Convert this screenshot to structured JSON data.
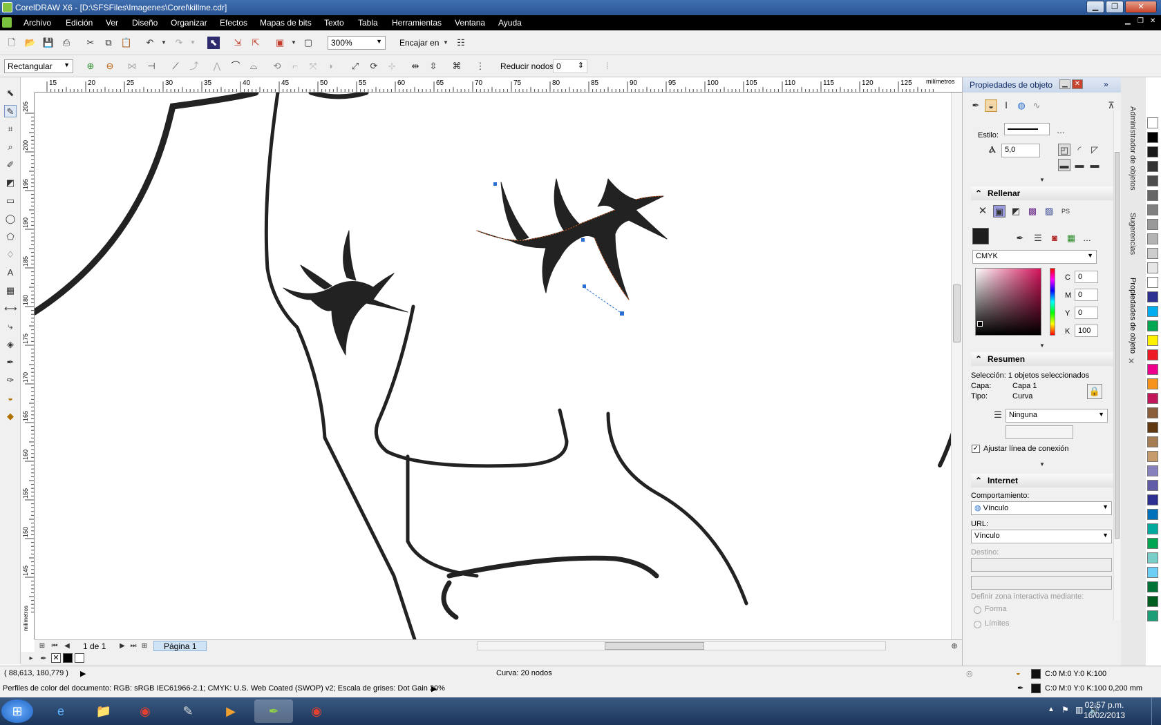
{
  "window": {
    "title": "CorelDRAW X6 - [D:\\SFSFiles\\Imagenes\\Corel\\killme.cdr]"
  },
  "menu": [
    "Archivo",
    "Edición",
    "Ver",
    "Diseño",
    "Organizar",
    "Efectos",
    "Mapas de bits",
    "Texto",
    "Tabla",
    "Herramientas",
    "Ventana",
    "Ayuda"
  ],
  "toolbar": {
    "zoom": "300%",
    "snap_label": "Encajar en"
  },
  "propbar": {
    "mode": "Rectangular",
    "reduce_label": "Reducir nodos",
    "reduce_value": "0"
  },
  "ruler": {
    "h_labels": [
      "15",
      "20",
      "25",
      "30",
      "35",
      "40",
      "45",
      "50",
      "55",
      "60",
      "65",
      "70",
      "75",
      "80",
      "85",
      "90",
      "95",
      "100",
      "105",
      "110",
      "115",
      "120",
      "125"
    ],
    "h_unit": "milímetros",
    "v_labels": [
      "205",
      "200",
      "195",
      "190",
      "185",
      "180",
      "175",
      "170",
      "165",
      "160",
      "155",
      "150",
      "145"
    ],
    "v_unit": "milímetros"
  },
  "pages": {
    "counter": "1 de 1",
    "tab": "Página 1"
  },
  "panel": {
    "title": "Propiedades de objeto",
    "estilo_label": "Estilo:",
    "width_value": "5,0",
    "fill_title": "Rellenar",
    "color_model": "CMYK",
    "cmyk": {
      "c_label": "C",
      "c": "0",
      "m_label": "M",
      "m": "0",
      "y_label": "Y",
      "y": "0",
      "k_label": "K",
      "k": "100"
    },
    "summary_title": "Resumen",
    "selection": "Selección: 1 objetos seleccionados",
    "layer_label": "Capa:",
    "layer_value": "Capa 1",
    "type_label": "Tipo:",
    "type_value": "Curva",
    "wrap_value": "Ninguna",
    "connector_label": "Ajustar línea de conexión",
    "internet_title": "Internet",
    "behavior_label": "Comportamiento:",
    "behavior_value": "Vínculo",
    "url_label": "URL:",
    "url_value": "Vínculo",
    "dest_label": "Destino:",
    "define_label": "Definir zona interactiva mediante:",
    "forma_label": "Forma",
    "limites_label": "Límites"
  },
  "sidetabs": [
    "Administrador de objetos",
    "Sugerencias",
    "Propiedades de objeto"
  ],
  "status": {
    "coords": "( 88,613, 180,779 )",
    "curve_info": "Curva: 20 nodos",
    "profile": "Perfiles de color del documento: RGB: sRGB IEC61966-2.1; CMYK: U.S. Web Coated (SWOP) v2; Escala de grises: Dot Gain 20%",
    "fill_info": "C:0 M:0 Y:0 K:100",
    "outline_info": "C:0 M:0 Y:0 K:100  0,200 mm"
  },
  "clock": {
    "time": "02:57 p.m.",
    "date": "16/02/2013"
  },
  "palette_colors": [
    "#ffffff",
    "#000000",
    "#1a1a1a",
    "#333333",
    "#4d4d4d",
    "#666666",
    "#808080",
    "#999999",
    "#b3b3b3",
    "#cccccc",
    "#e6e6e6",
    "#ffffff",
    "#2e3192",
    "#00aeef",
    "#00a651",
    "#fff200",
    "#ed1c24",
    "#ec008c",
    "#f7941d",
    "#c2185b",
    "#8b5e3c",
    "#603913",
    "#a67c52",
    "#c69c6d",
    "#8781bd",
    "#605ca8",
    "#2e3192",
    "#0072bc",
    "#00a99d",
    "#00a651",
    "#7accc8",
    "#6dcff6",
    "#007236",
    "#005e20",
    "#1b9e77"
  ]
}
